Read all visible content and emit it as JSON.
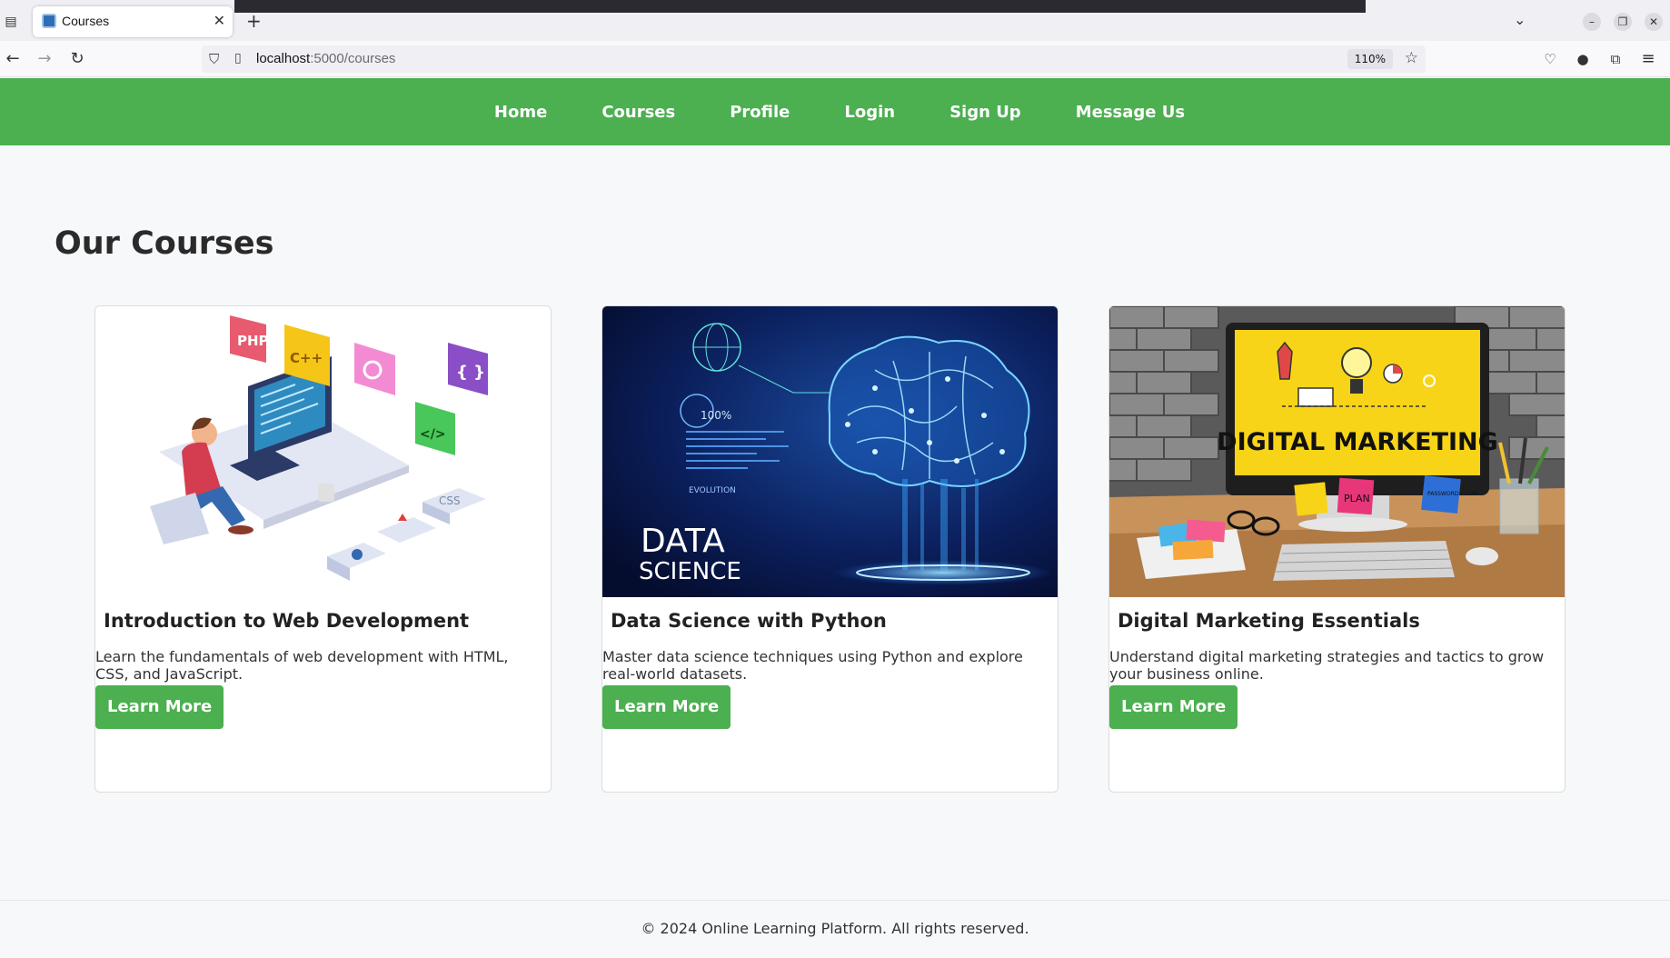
{
  "browser": {
    "tab_title": "Courses",
    "url_host": "localhost",
    "url_path": ":5000/courses",
    "zoom": "110%"
  },
  "nav": {
    "items": [
      {
        "label": "Home"
      },
      {
        "label": "Courses"
      },
      {
        "label": "Profile"
      },
      {
        "label": "Login"
      },
      {
        "label": "Sign Up"
      },
      {
        "label": "Message Us"
      }
    ]
  },
  "main": {
    "title": "Our Courses",
    "courses": [
      {
        "title": "Introduction to Web Development",
        "description": "Learn the fundamentals of web development with HTML, CSS, and JavaScript.",
        "button": "Learn More"
      },
      {
        "title": "Data Science with Python",
        "description": "Master data science techniques using Python and explore real-world datasets.",
        "button": "Learn More",
        "image_text": [
          "DATA",
          "SCIENCE",
          "100%",
          "EVOLUTION"
        ]
      },
      {
        "title": "Digital Marketing Essentials",
        "description": "Understand digital marketing strategies and tactics to grow your business online.",
        "button": "Learn More",
        "image_text": [
          "DIGITAL MARKETING",
          "PLAN",
          "PASSWORD LOGIN"
        ]
      }
    ],
    "web_dev_image_labels": [
      "PHP",
      "C++",
      "{ }",
      "</>",
      "CSS"
    ]
  },
  "footer": {
    "text": "© 2024 Online Learning Platform. All rights reserved."
  },
  "colors": {
    "brand_green": "#4caf50",
    "page_bg": "#f6f8fa"
  }
}
